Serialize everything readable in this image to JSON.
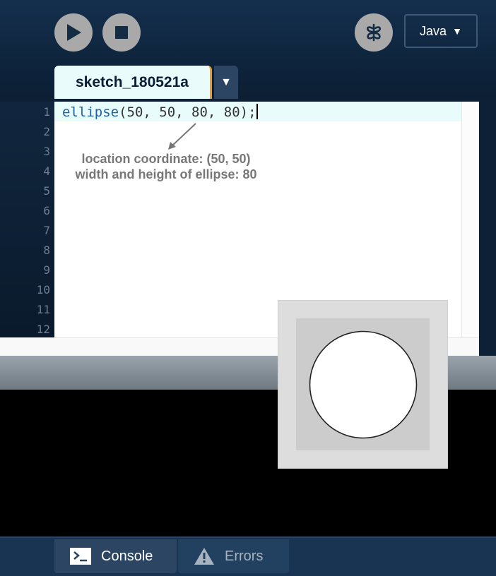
{
  "toolbar": {
    "run_icon": "play-icon",
    "stop_icon": "stop-icon",
    "debug_icon": "butterfly-icon",
    "mode_label": "Java",
    "mode_arrow": "▼"
  },
  "tabs": [
    {
      "label": "sketch_180521a",
      "active": true
    }
  ],
  "tab_menu_arrow": "▼",
  "editor": {
    "line_numbers": [
      "1",
      "2",
      "3",
      "4",
      "5",
      "6",
      "7",
      "8",
      "9",
      "10",
      "11",
      "12"
    ],
    "code_fn": "ellipse",
    "code_args": "(50, 50, 80, 80);",
    "annotation_line1": "location coordinate: (50, 50)",
    "annotation_line2": "width and height of ellipse: 80"
  },
  "footer": {
    "console_label": "Console",
    "errors_label": "Errors"
  },
  "colors": {
    "background": "#0d2036",
    "accent_tab_border": "#f59a22",
    "keyword": "#1e5fa6",
    "current_line": "#e8fcfc"
  }
}
